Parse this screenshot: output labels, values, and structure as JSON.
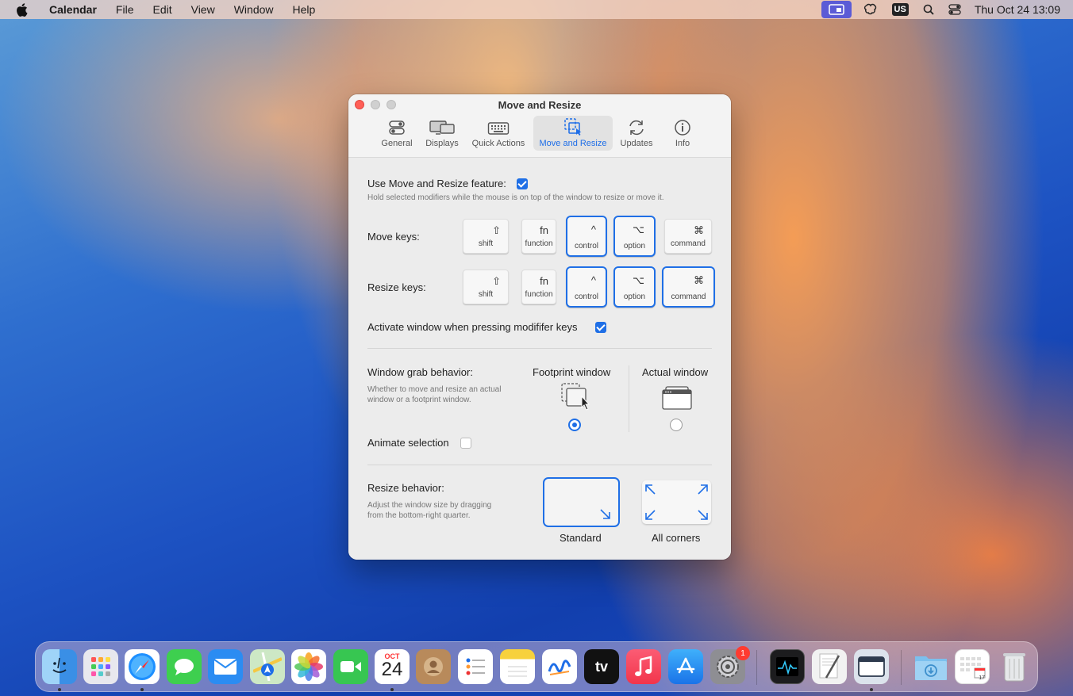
{
  "menubar": {
    "app_name": "Calendar",
    "items": [
      "File",
      "Edit",
      "View",
      "Window",
      "Help"
    ],
    "keyboard_layout": "US",
    "clock": "Thu Oct 24  13:09"
  },
  "window": {
    "title": "Move and Resize",
    "tabs": [
      {
        "label": "General",
        "icon": "toggles-icon"
      },
      {
        "label": "Displays",
        "icon": "displays-icon"
      },
      {
        "label": "Quick Actions",
        "icon": "keyboard-icon"
      },
      {
        "label": "Move and Resize",
        "icon": "move-resize-icon",
        "active": true
      },
      {
        "label": "Updates",
        "icon": "refresh-icon"
      },
      {
        "label": "Info",
        "icon": "info-icon"
      }
    ]
  },
  "settings": {
    "use_feature_label": "Use Move and Resize feature:",
    "use_feature_checked": true,
    "use_feature_desc": "Hold selected modifiers while the mouse is on top of the window to resize or move it.",
    "move_keys_label": "Move keys:",
    "resize_keys_label": "Resize keys:",
    "keys": [
      {
        "symbol": "⇧",
        "name": "shift"
      },
      {
        "symbol": "fn",
        "name": "function"
      },
      {
        "symbol": "^",
        "name": "control"
      },
      {
        "symbol": "⌥",
        "name": "option"
      },
      {
        "symbol": "⌘",
        "name": "command"
      }
    ],
    "move_keys_selected": [
      "control",
      "option"
    ],
    "resize_keys_selected": [
      "control",
      "option",
      "command"
    ],
    "activate_label": "Activate window when pressing modififer keys",
    "activate_checked": true,
    "grab_label": "Window grab behavior:",
    "grab_desc_1": "Whether to move and resize an actual",
    "grab_desc_2": "window or a footprint window.",
    "grab_option_footprint": "Footprint window",
    "grab_option_actual": "Actual window",
    "grab_selected": "Footprint window",
    "animate_label": "Animate selection",
    "animate_checked": false,
    "resize_label": "Resize behavior:",
    "resize_desc_1": "Adjust the window size by dragging",
    "resize_desc_2": "from the bottom-right quarter.",
    "resize_option_standard": "Standard",
    "resize_option_corners": "All corners",
    "resize_selected": "Standard"
  },
  "dock": {
    "apps": [
      "Finder",
      "Launchpad",
      "Safari",
      "Messages",
      "Mail",
      "Maps",
      "Photos",
      "FaceTime",
      "Calendar",
      "Contacts",
      "Reminders",
      "Notes",
      "Freeform",
      "TV",
      "Music",
      "App Store",
      "System Settings",
      "Activity Monitor",
      "TextEdit",
      "Window Manager",
      "Downloads",
      "Calendar Widget",
      "Trash"
    ],
    "calendar_month": "OCT",
    "calendar_day": "24",
    "settings_badge": "1",
    "tv_label": "tv",
    "widget_day": "17"
  }
}
